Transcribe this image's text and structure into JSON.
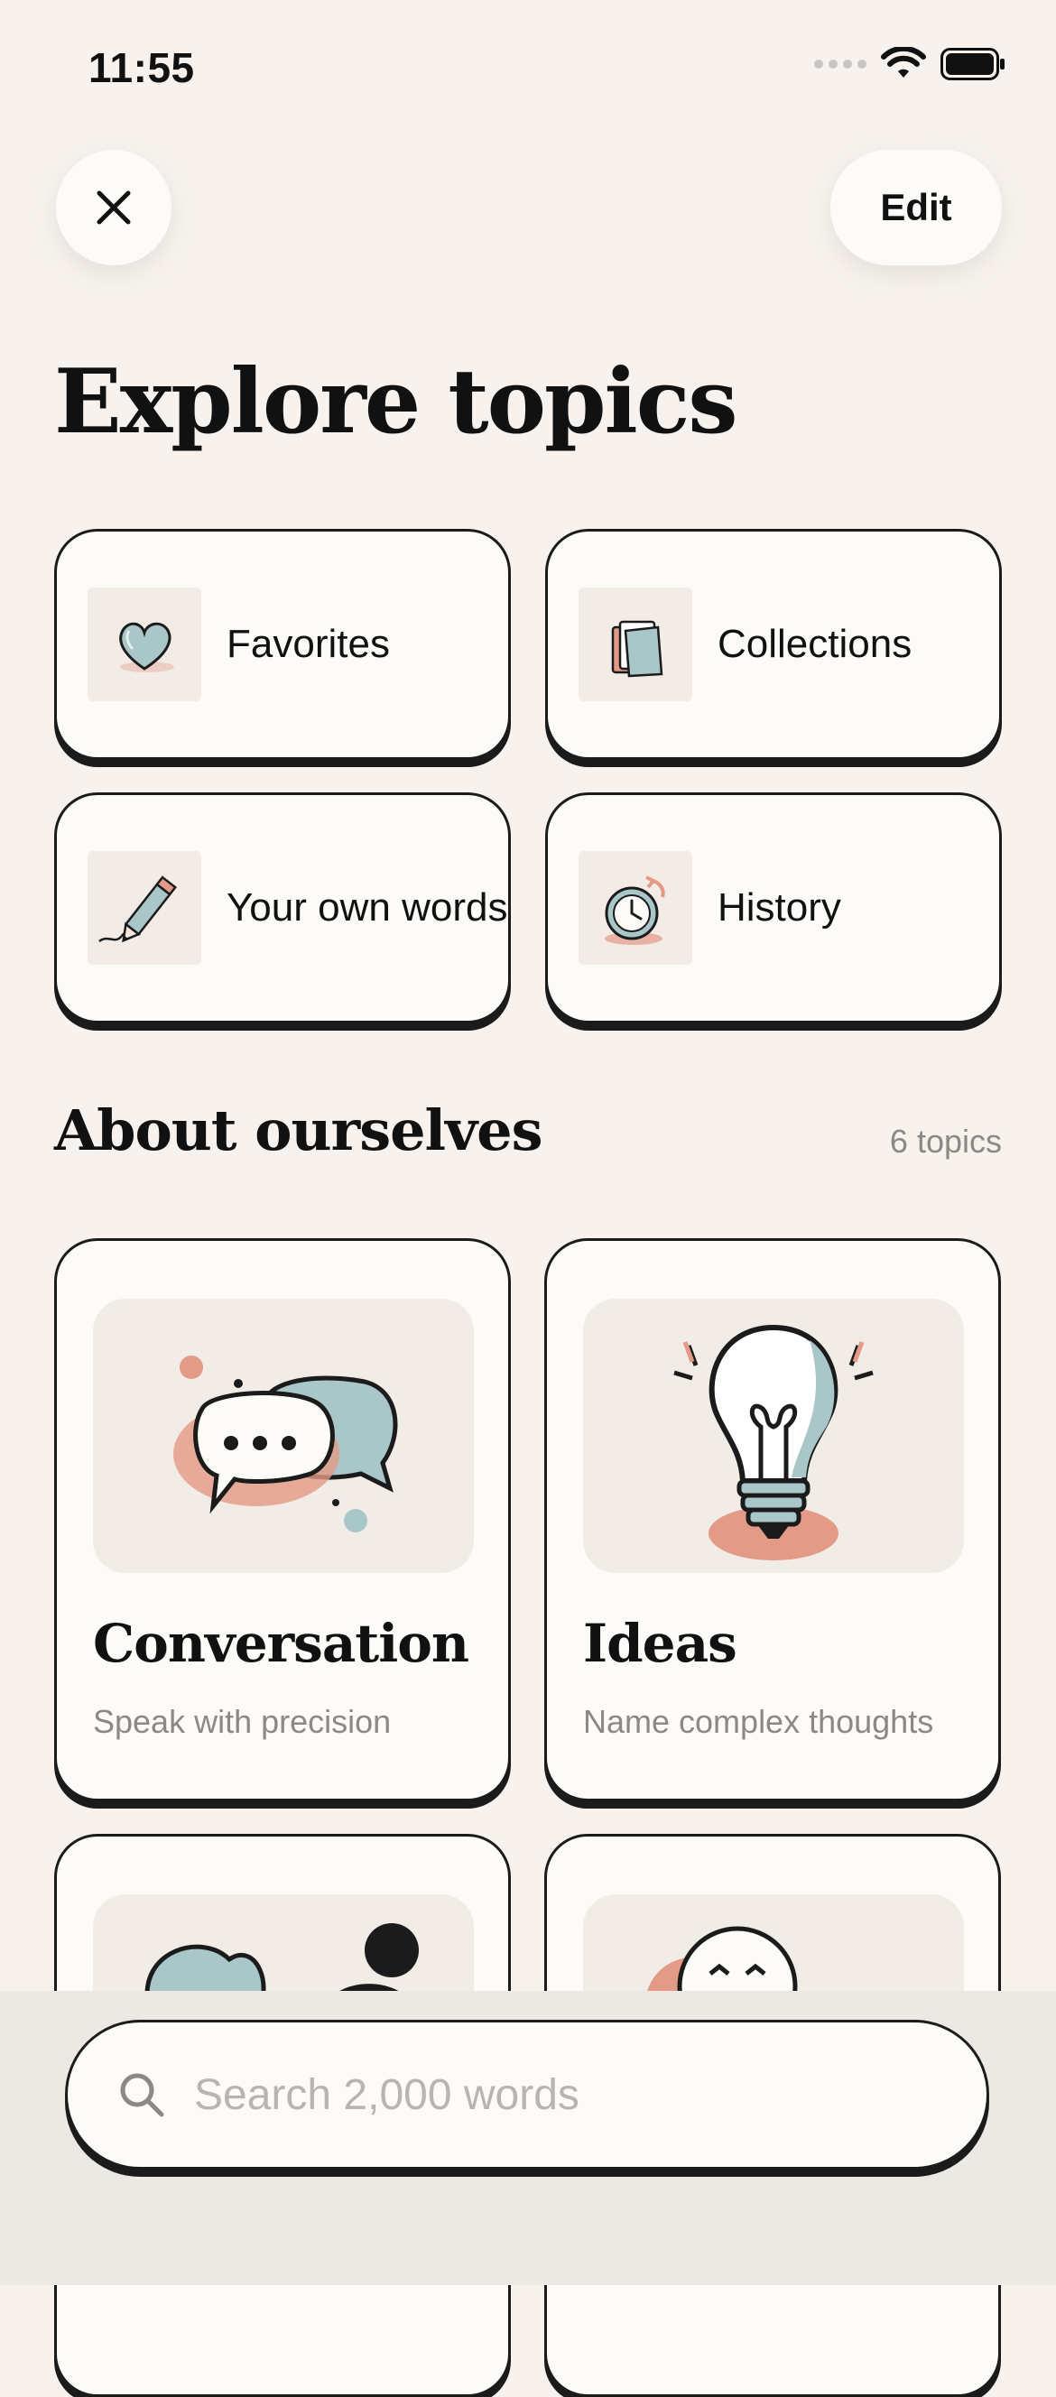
{
  "status": {
    "time": "11:55"
  },
  "header": {
    "edit_label": "Edit",
    "title": "Explore topics"
  },
  "quick_links": [
    {
      "label": "Favorites",
      "icon": "heart-icon"
    },
    {
      "label": "Collections",
      "icon": "folder-icon"
    },
    {
      "label": "Your own words",
      "icon": "pencil-icon"
    },
    {
      "label": "History",
      "icon": "clock-icon"
    }
  ],
  "section": {
    "title": "About ourselves",
    "count": "6 topics"
  },
  "topics": [
    {
      "title": "Conversation",
      "subtitle": "Speak with precision",
      "icon": "speech-bubbles-icon"
    },
    {
      "title": "Ideas",
      "subtitle": "Name complex thoughts",
      "icon": "lightbulb-icon"
    },
    {
      "title": "",
      "subtitle": "",
      "icon": "people-icon"
    },
    {
      "title": "",
      "subtitle": "",
      "icon": "faces-icon"
    }
  ],
  "search": {
    "placeholder": "Search 2,000 words"
  },
  "colors": {
    "background": "#f7f2ee",
    "card": "#fdfbf8",
    "accent_teal": "#a9c6c9",
    "accent_coral": "#e39a86"
  }
}
